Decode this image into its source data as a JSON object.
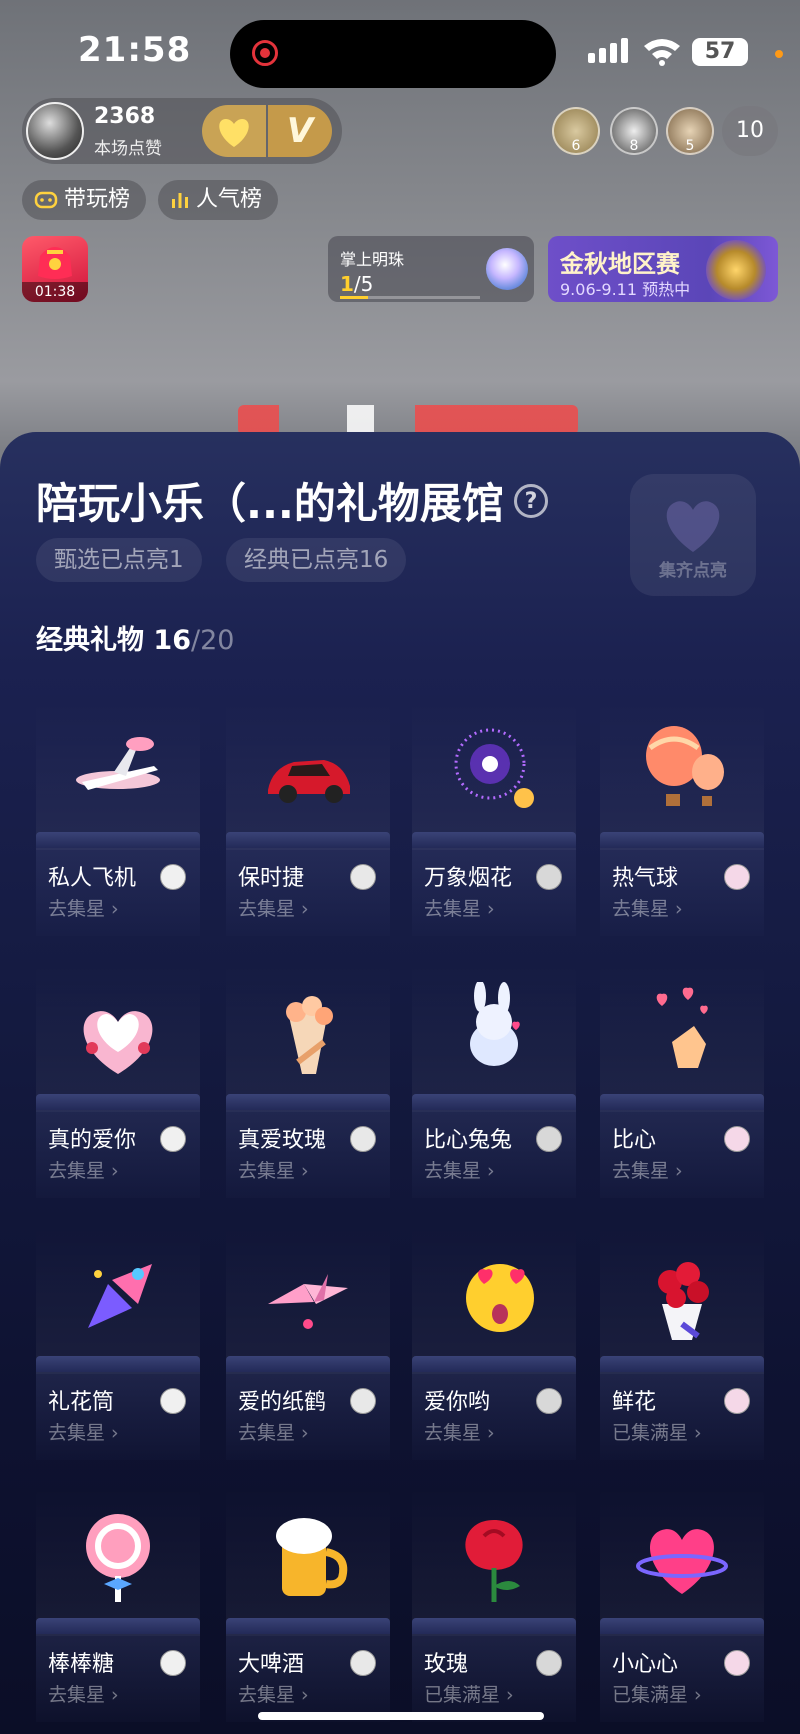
{
  "status_bar": {
    "time": "21:58",
    "battery": "57"
  },
  "host": {
    "likes": "2368",
    "likes_label": "本场点赞"
  },
  "viewers": {
    "badges": [
      "6",
      "8",
      "5"
    ],
    "count": "10"
  },
  "rank_chips": [
    {
      "label": "带玩榜",
      "icon": "gamepad-icon"
    },
    {
      "label": "人气榜",
      "icon": "bar-chart-icon"
    }
  ],
  "gift_timer": {
    "time": "01:38"
  },
  "pearl_event": {
    "title": "掌上明珠",
    "current": "1",
    "total": "/5",
    "progress": 0.2
  },
  "autumn_event": {
    "title": "金秋地区赛",
    "subtitle": "9.06-9.11 预热中"
  },
  "panel": {
    "title": "陪玩小乐（...的礼物展馆",
    "stats": [
      "甄选已点亮1",
      "经典已点亮16"
    ],
    "badge_label": "集齐点亮",
    "section": {
      "title": "经典礼物",
      "lit": "16",
      "total": "/20"
    }
  },
  "gifts": [
    {
      "name": "私人飞机",
      "action": "去集星",
      "icon": "airplane-icon"
    },
    {
      "name": "保时捷",
      "action": "去集星",
      "icon": "sports-car-icon"
    },
    {
      "name": "万象烟花",
      "action": "去集星",
      "icon": "fireworks-icon"
    },
    {
      "name": "热气球",
      "action": "去集星",
      "icon": "hot-air-balloon-icon"
    },
    {
      "name": "真的爱你",
      "action": "去集星",
      "icon": "heart-cake-icon"
    },
    {
      "name": "真爱玫瑰",
      "action": "去集星",
      "icon": "bouquet-icon"
    },
    {
      "name": "比心兔兔",
      "action": "去集星",
      "icon": "bunny-icon"
    },
    {
      "name": "比心",
      "action": "去集星",
      "icon": "finger-heart-icon"
    },
    {
      "name": "礼花筒",
      "action": "去集星",
      "icon": "party-popper-icon"
    },
    {
      "name": "爱的纸鹤",
      "action": "去集星",
      "icon": "paper-crane-icon"
    },
    {
      "name": "爱你哟",
      "action": "去集星",
      "icon": "heart-eyes-icon"
    },
    {
      "name": "鲜花",
      "action": "已集满星",
      "icon": "roses-icon"
    },
    {
      "name": "棒棒糖",
      "action": "去集星",
      "icon": "lollipop-icon"
    },
    {
      "name": "大啤酒",
      "action": "去集星",
      "icon": "beer-icon"
    },
    {
      "name": "玫瑰",
      "action": "已集满星",
      "icon": "rose-icon"
    },
    {
      "name": "小心心",
      "action": "已集满星",
      "icon": "little-heart-icon"
    }
  ],
  "colors": {
    "panel_top": "#27305f",
    "panel_bottom": "#0b0e27",
    "accent_gold": "#ffcf2e"
  }
}
